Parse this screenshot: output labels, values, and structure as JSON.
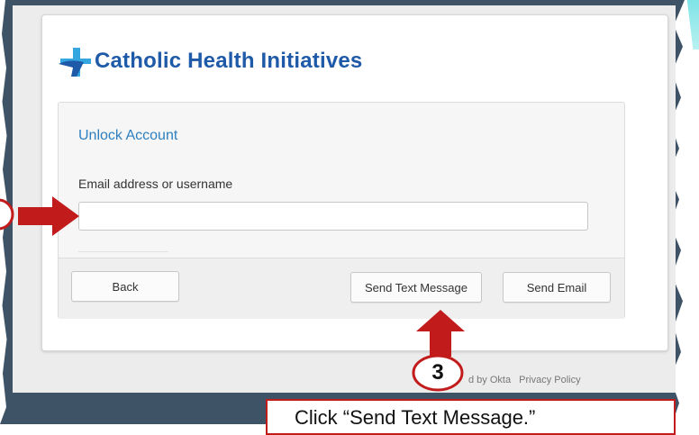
{
  "brand": {
    "name": "Catholic Health Initiatives",
    "colors": {
      "primary": "#1f5aa8",
      "accent": "#35a7e0",
      "link": "#2d7fbf"
    }
  },
  "form": {
    "title": "Unlock Account",
    "field_label": "Email address or username",
    "field_value": "",
    "buttons": {
      "back": "Back",
      "send_text": "Send Text Message",
      "send_email": "Send Email"
    }
  },
  "footer": {
    "powered_text": "d by Okta",
    "privacy_link": "Privacy Policy"
  },
  "annotation": {
    "step_number": "3",
    "callout_text": "Click “Send Text Message.”",
    "highlight_color": "#c21b1b"
  }
}
